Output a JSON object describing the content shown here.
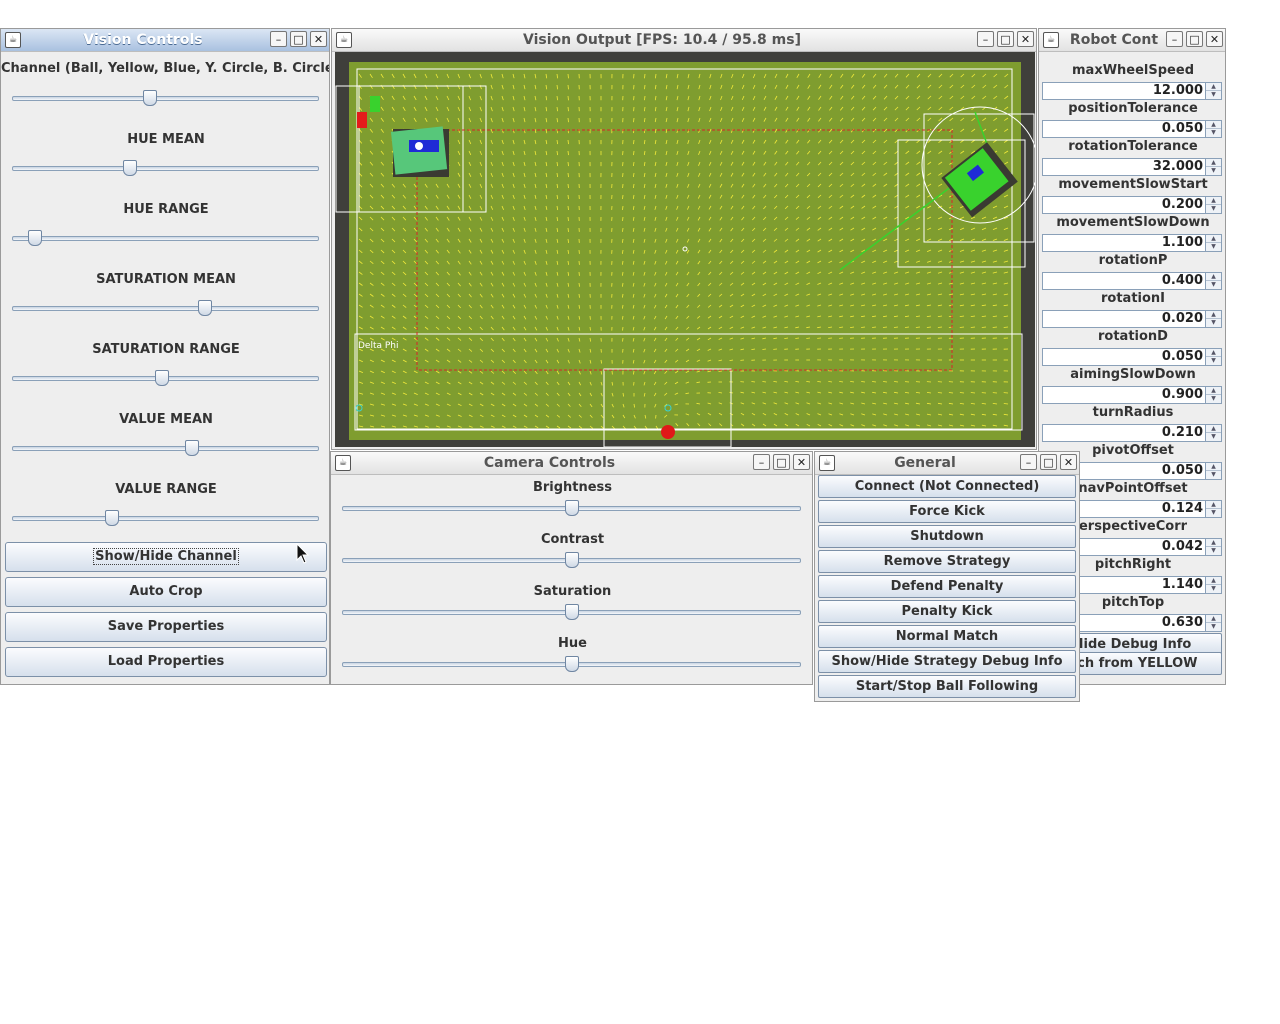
{
  "vision_controls": {
    "title": "Vision Controls",
    "channel_label": "Channel (Ball, Yellow, Blue, Y. Circle, B. Circle)",
    "channel_slider": 0.45,
    "sliders": [
      {
        "label": "HUE MEAN",
        "value": 0.385
      },
      {
        "label": "HUE RANGE",
        "value": 0.075
      },
      {
        "label": "SATURATION MEAN",
        "value": 0.63
      },
      {
        "label": "SATURATION RANGE",
        "value": 0.49
      },
      {
        "label": "VALUE MEAN",
        "value": 0.585
      },
      {
        "label": "VALUE RANGE",
        "value": 0.325
      }
    ],
    "buttons": [
      "Show/Hide Channel",
      "Auto Crop",
      "Save Properties",
      "Load Properties"
    ]
  },
  "vision_output": {
    "title": "Vision Output [FPS: 10.4 / 95.8 ms]",
    "field_label": "Delta Phi"
  },
  "robot_controls": {
    "title": "Robot Cont",
    "params": [
      {
        "label": "maxWheelSpeed",
        "value": "12.000"
      },
      {
        "label": "positionTolerance",
        "value": "0.050"
      },
      {
        "label": "rotationTolerance",
        "value": "32.000"
      },
      {
        "label": "movementSlowStart",
        "value": "0.200"
      },
      {
        "label": "movementSlowDown",
        "value": "1.100"
      },
      {
        "label": "rotationP",
        "value": "0.400"
      },
      {
        "label": "rotationI",
        "value": "0.020"
      },
      {
        "label": "rotationD",
        "value": "0.050"
      },
      {
        "label": "aimingSlowDown",
        "value": "0.900"
      },
      {
        "label": "turnRadius",
        "value": "0.210"
      },
      {
        "label": "pivotOffset",
        "value": "0.050"
      },
      {
        "label": "navPointOffset",
        "value": "0.124"
      },
      {
        "label": "erspectiveCorr",
        "value": "0.042"
      },
      {
        "label": "pitchRight",
        "value": "1.140"
      },
      {
        "label": "pitchTop",
        "value": "0.630"
      }
    ],
    "buttons": [
      "Hide Debug Info",
      "itch from YELLOW"
    ]
  },
  "camera_controls": {
    "title": "Camera Controls",
    "sliders": [
      {
        "label": "Brightness",
        "value": 0.5
      },
      {
        "label": "Contrast",
        "value": 0.5
      },
      {
        "label": "Saturation",
        "value": 0.5
      },
      {
        "label": "Hue",
        "value": 0.5
      }
    ]
  },
  "general": {
    "title": "General",
    "buttons": [
      "Connect (Not Connected)",
      "Force Kick",
      "Shutdown",
      "Remove Strategy",
      "Defend Penalty",
      "Penalty Kick",
      "Normal Match",
      "Show/Hide Strategy Debug Info",
      "Start/Stop Ball Following"
    ]
  },
  "window_buttons": {
    "minimize": "–",
    "maximize": "□",
    "close": "✕"
  },
  "colors": {
    "field": "#7a9a2c",
    "vector": "#f2ea3a",
    "ball": "#e01818",
    "title_active": "#a9c1e0"
  }
}
